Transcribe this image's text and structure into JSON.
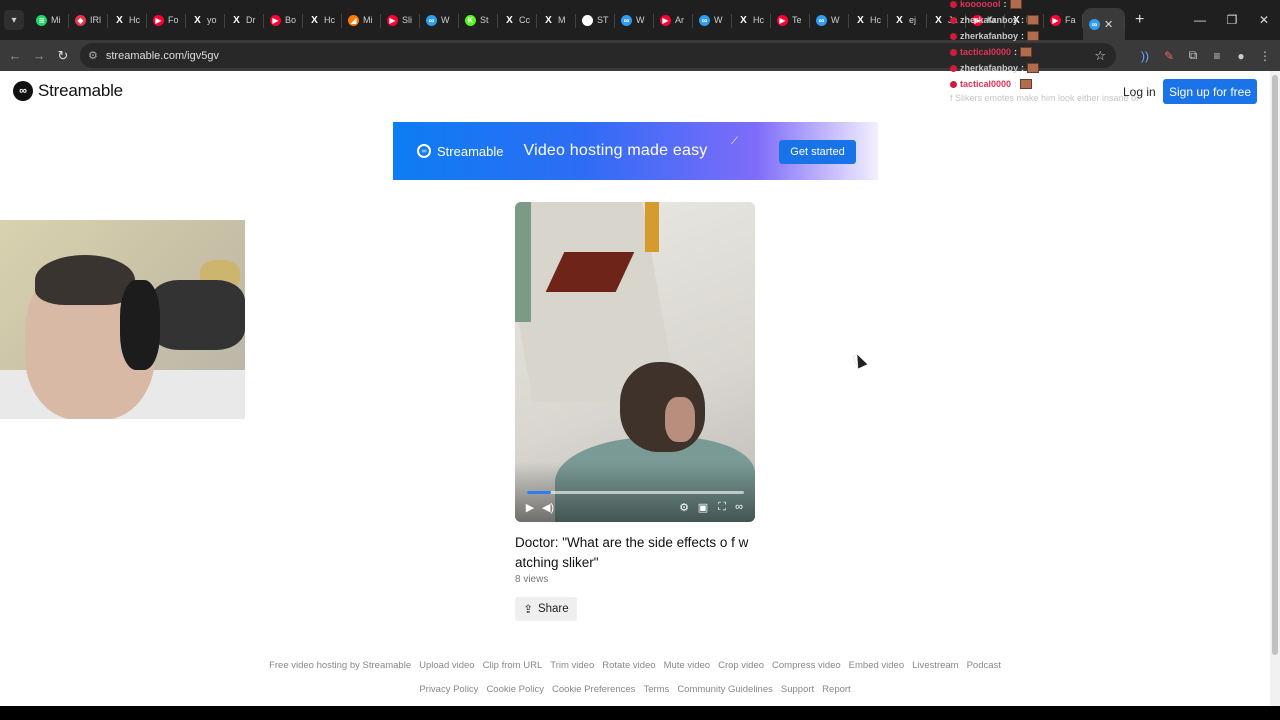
{
  "browser": {
    "tabs": [
      {
        "label": "Mi",
        "icon": "spotify-icon",
        "color": "#1ed760"
      },
      {
        "label": "IRl",
        "icon": "bookmark-icon",
        "color": "#e8334a"
      },
      {
        "label": "Hc",
        "icon": "x-icon",
        "color": "#ffffff"
      },
      {
        "label": "Fo",
        "icon": "youtube-icon",
        "color": "#ff0033"
      },
      {
        "label": "yo",
        "icon": "x-icon",
        "color": "#ffffff"
      },
      {
        "label": "Dr",
        "icon": "x-icon",
        "color": "#ffffff"
      },
      {
        "label": "Bo",
        "icon": "youtube-icon",
        "color": "#ff0033"
      },
      {
        "label": "Hc",
        "icon": "x-icon",
        "color": "#ffffff"
      },
      {
        "label": "Mi",
        "icon": "music-icon",
        "color": "#ff7a00"
      },
      {
        "label": "Sli",
        "icon": "youtube-icon",
        "color": "#ff0033"
      },
      {
        "label": "W",
        "icon": "streamable-icon",
        "color": "#2f9cf5"
      },
      {
        "label": "St",
        "icon": "kick-icon",
        "color": "#53fc18"
      },
      {
        "label": "Cc",
        "icon": "x-icon",
        "color": "#ffffff"
      },
      {
        "label": "M",
        "icon": "x-icon",
        "color": "#ffffff"
      },
      {
        "label": "ST",
        "icon": "tiktok-icon",
        "color": "#ffffff"
      },
      {
        "label": "W",
        "icon": "streamable-icon",
        "color": "#2f9cf5"
      },
      {
        "label": "Ar",
        "icon": "youtube-icon",
        "color": "#ff0033"
      },
      {
        "label": "W",
        "icon": "streamable-icon",
        "color": "#2f9cf5"
      },
      {
        "label": "Hc",
        "icon": "x-icon",
        "color": "#ffffff"
      },
      {
        "label": "Te",
        "icon": "youtube-icon",
        "color": "#ff0033"
      },
      {
        "label": "W",
        "icon": "streamable-icon",
        "color": "#2f9cf5"
      },
      {
        "label": "Hc",
        "icon": "x-icon",
        "color": "#ffffff"
      },
      {
        "label": "ej",
        "icon": "x-icon",
        "color": "#ffffff"
      },
      {
        "label": "Ja",
        "icon": "x-icon",
        "color": "#ffffff"
      },
      {
        "label": "Kr",
        "icon": "youtube-icon",
        "color": "#ff0033"
      },
      {
        "label": "Hc",
        "icon": "x-icon",
        "color": "#ffffff"
      },
      {
        "label": "Fa",
        "icon": "youtube-icon",
        "color": "#ff0033"
      }
    ],
    "active_tab_icon": "streamable-icon",
    "new_tab_label": "+",
    "url": "streamable.com/igv5gv"
  },
  "header": {
    "logo_text": "Streamable",
    "login_label": "Log in",
    "signup_label": "Sign up for free"
  },
  "banner": {
    "logo_text": "Streamable",
    "tagline": "Video hosting made easy",
    "cta_label": "Get started"
  },
  "video": {
    "title": "Doctor: \"What are the side effects o f watching sliker\"",
    "views": "8 views",
    "progress_fraction": 0.11,
    "share_label": "Share"
  },
  "footer": {
    "row1": [
      "Free video hosting by Streamable",
      "Upload video",
      "Clip from URL",
      "Trim video",
      "Rotate video",
      "Mute video",
      "Crop video",
      "Compress video",
      "Embed video",
      "Livestream",
      "Podcast"
    ],
    "row2": [
      "Privacy Policy",
      "Cookie Policy",
      "Cookie Preferences",
      "Terms",
      "Community Guidelines",
      "Support",
      "Report"
    ]
  },
  "chat_overlay": {
    "lines": [
      {
        "user": "kooooool",
        "color": "#e0325a"
      },
      {
        "user": "zherkafanboy",
        "color": "#c8c8c8"
      },
      {
        "user": "zherkafanboy",
        "color": "#c8c8c8"
      },
      {
        "user": "tactical0000",
        "color": "#e0325a"
      },
      {
        "user": "zherkafanboy",
        "color": "#c8c8c8"
      },
      {
        "user": "tactical0000",
        "color": "#e0325a"
      }
    ],
    "separator": ":",
    "message": "f Slikers emotes make him look either insane or"
  },
  "colors": {
    "accent": "#1a73e8",
    "page_bg": "#ffffff",
    "chrome_dark": "#1f1f1f"
  }
}
